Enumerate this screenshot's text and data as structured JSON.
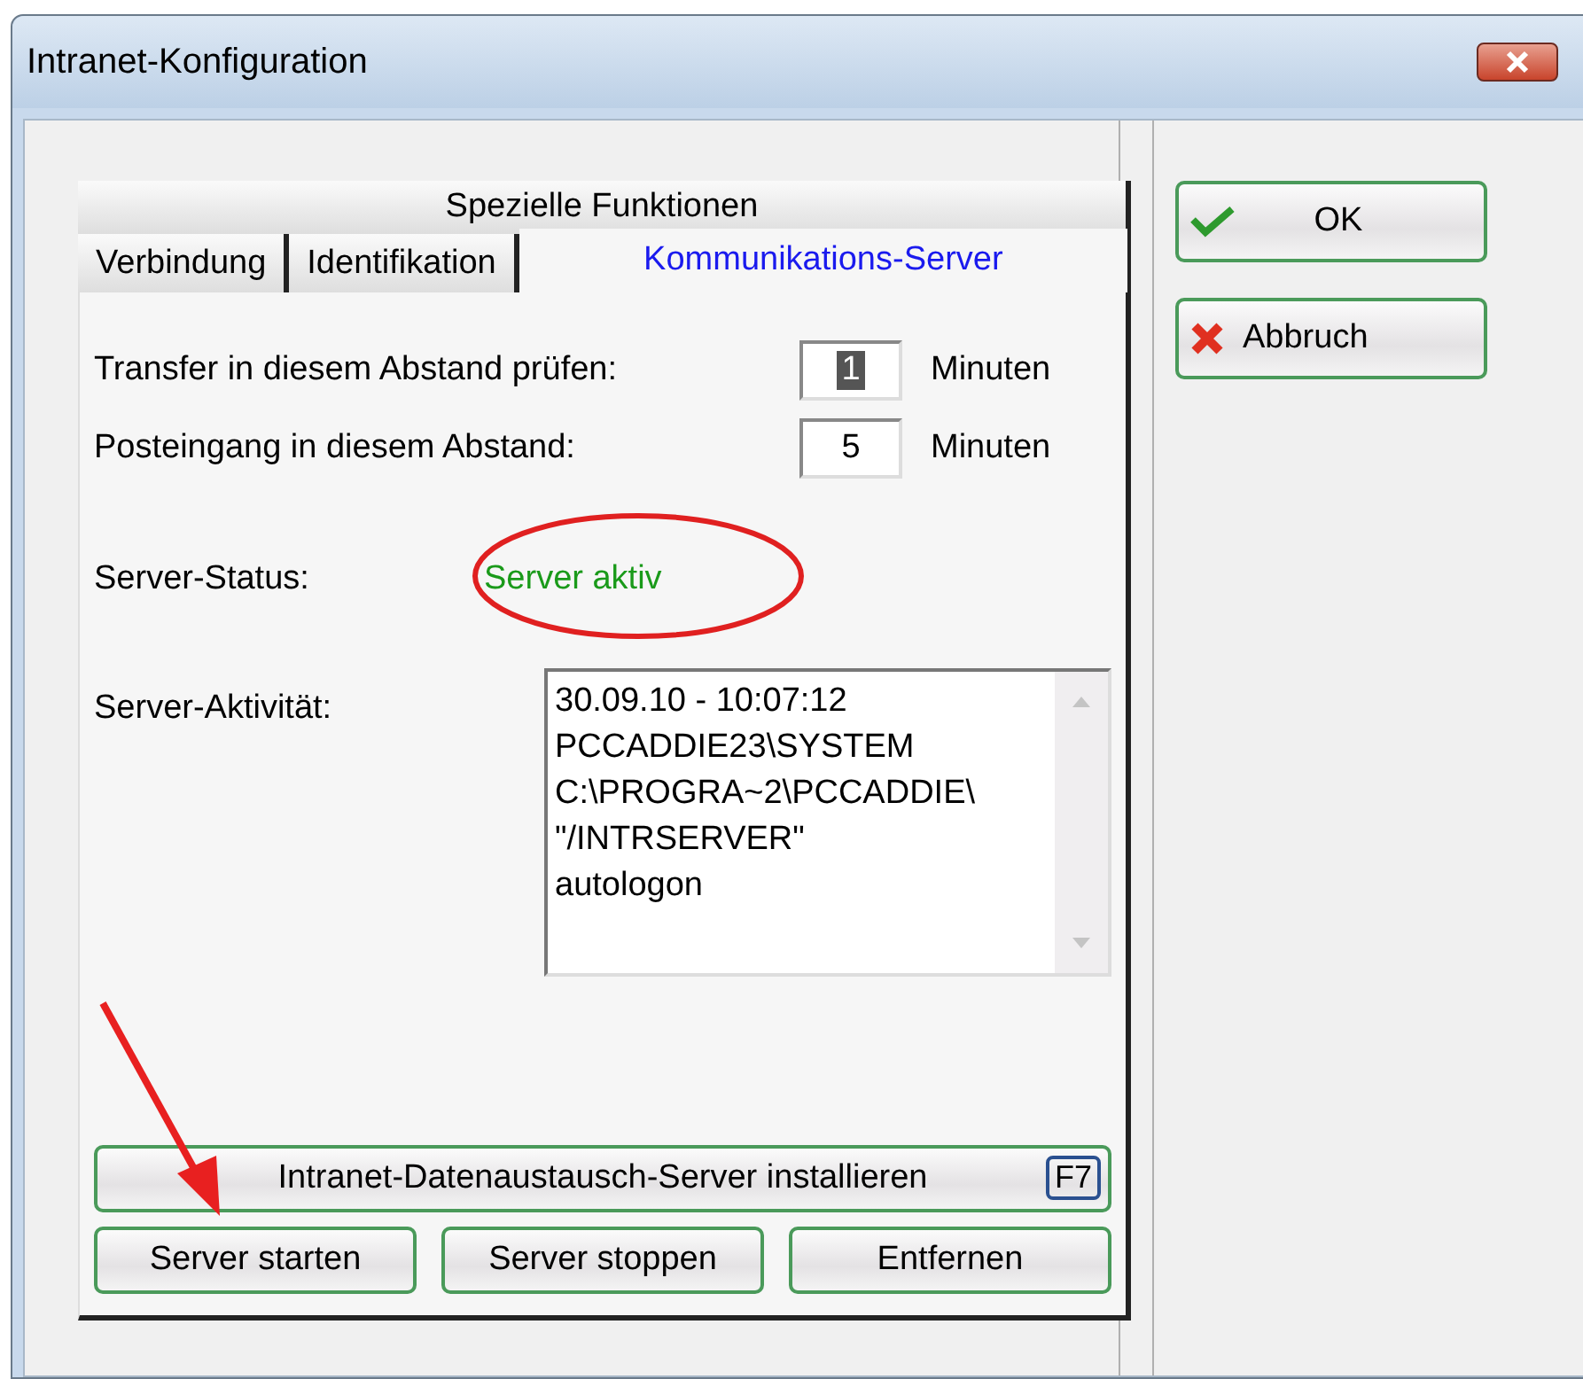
{
  "window": {
    "title": "Intranet-Konfiguration"
  },
  "tab_rows": [
    [
      {
        "label": "Spezielle Funktionen",
        "selected": false
      }
    ],
    [
      {
        "label": "Verbindung",
        "selected": false
      },
      {
        "label": "Identifikation",
        "selected": false
      },
      {
        "label": "Kommunikations-Server",
        "selected": true
      }
    ]
  ],
  "interval_fields": [
    {
      "label": "Transfer in diesem Abstand prüfen:",
      "value": "1",
      "text_selected": true,
      "unit": "Minuten"
    },
    {
      "label": "Posteingang in diesem Abstand:",
      "value": "5",
      "text_selected": false,
      "unit": "Minuten"
    }
  ],
  "server_status": {
    "label": "Server-Status:",
    "value": "Server aktiv"
  },
  "server_activity": {
    "label": "Server-Aktivität:",
    "lines": [
      "30.09.10 - 10:07:12",
      "PCCADDIE23\\SYSTEM",
      "C:\\PROGRA~2\\PCCADDIE\\",
      "\"/INTRSERVER\"",
      "autologon"
    ]
  },
  "install_button": {
    "label": "Intranet-Datenaustausch-Server installieren",
    "shortcut": "F7"
  },
  "server_buttons": [
    "Server starten",
    "Server stoppen",
    "Entfernen"
  ],
  "side_buttons": [
    {
      "kind": "ok",
      "label": "OK"
    },
    {
      "kind": "cancel",
      "label": "Abbruch"
    }
  ]
}
